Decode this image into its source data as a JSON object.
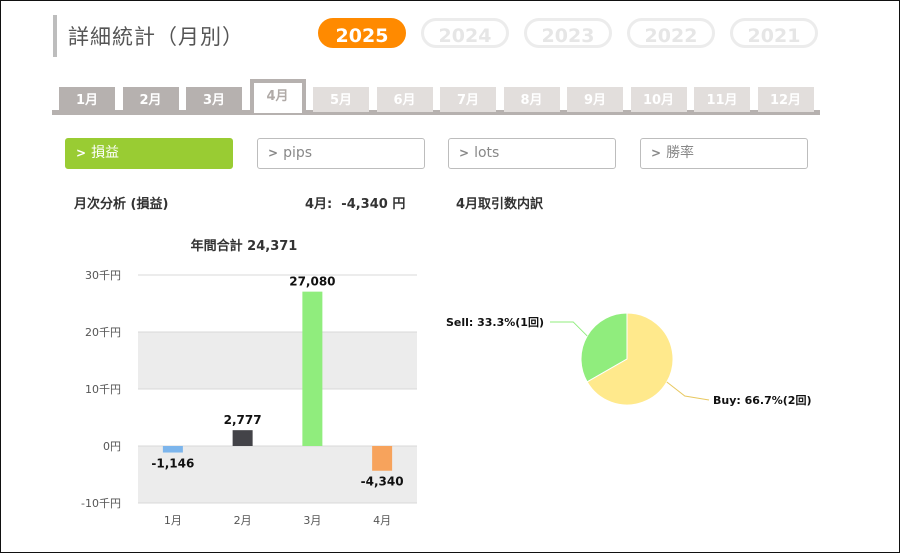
{
  "header": {
    "title": "詳細統計（月別）",
    "years": [
      {
        "label": "2025",
        "active": true
      },
      {
        "label": "2024",
        "active": false
      },
      {
        "label": "2023",
        "active": false
      },
      {
        "label": "2022",
        "active": false
      },
      {
        "label": "2021",
        "active": false
      }
    ]
  },
  "months": [
    {
      "label": "1月",
      "state": "normal"
    },
    {
      "label": "2月",
      "state": "normal"
    },
    {
      "label": "3月",
      "state": "normal"
    },
    {
      "label": "4月",
      "state": "active"
    },
    {
      "label": "5月",
      "state": "dim"
    },
    {
      "label": "6月",
      "state": "dim"
    },
    {
      "label": "7月",
      "state": "dim"
    },
    {
      "label": "8月",
      "state": "dim"
    },
    {
      "label": "9月",
      "state": "dim"
    },
    {
      "label": "10月",
      "state": "dim"
    },
    {
      "label": "11月",
      "state": "dim"
    },
    {
      "label": "12月",
      "state": "dim"
    }
  ],
  "metrics": [
    {
      "label": "損益",
      "active": true
    },
    {
      "label": "pips",
      "active": false
    },
    {
      "label": "lots",
      "active": false
    },
    {
      "label": "勝率",
      "active": false
    }
  ],
  "summary": {
    "analysis_label": "月次分析 (損益)",
    "month_total_label": "4月:  -4,340 円",
    "breakdown_label": "4月取引数内訳"
  },
  "colors": {
    "accent_orange": "#ff8a00",
    "accent_green": "#99cc33"
  },
  "chart_data": [
    {
      "type": "bar",
      "title": "年間合計 24,371",
      "categories": [
        "1月",
        "2月",
        "3月",
        "4月"
      ],
      "values": [
        -1146,
        2777,
        27080,
        -4340
      ],
      "data_labels": [
        "-1,146",
        "2,777",
        "27,080",
        "-4,340"
      ],
      "colors": [
        "#7cb5ec",
        "#434348",
        "#90ed7d",
        "#f7a35c"
      ],
      "y_ticks": [
        {
          "value": 30000,
          "label": "30千円"
        },
        {
          "value": 20000,
          "label": "20千円"
        },
        {
          "value": 10000,
          "label": "10千円"
        },
        {
          "value": 0,
          "label": "0円"
        },
        {
          "value": -10000,
          "label": "-10千円"
        }
      ],
      "ylim": [
        -10000,
        30000
      ],
      "grid": true
    },
    {
      "type": "pie",
      "slices": [
        {
          "label": "Sell: 33.3%(1回)",
          "value": 33.3,
          "count": 1,
          "color": "#90ed7d"
        },
        {
          "label": "Buy: 66.7%(2回)",
          "value": 66.7,
          "count": 2,
          "color": "#ffe98c"
        }
      ]
    }
  ]
}
